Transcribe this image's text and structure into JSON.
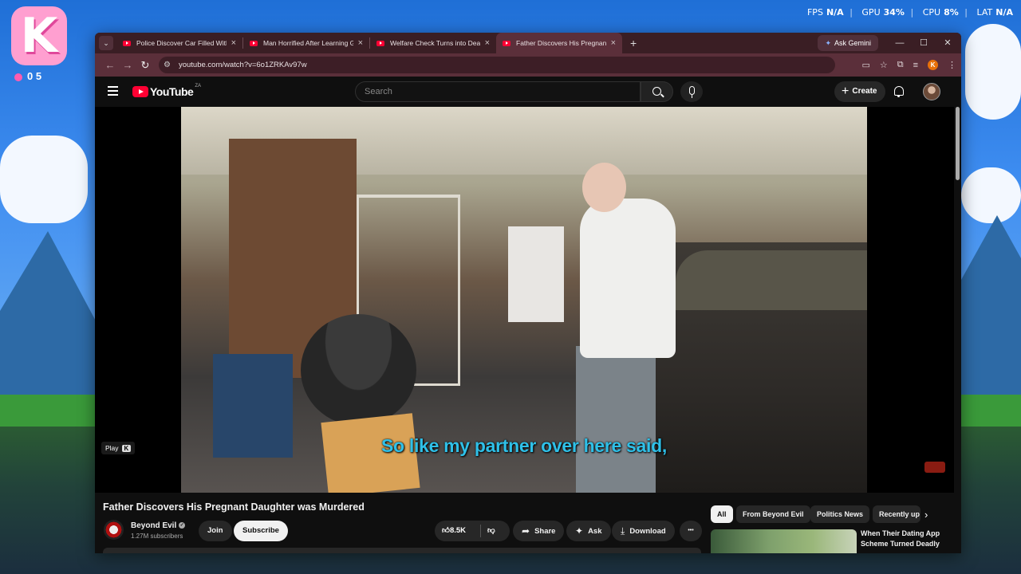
{
  "desktop": {
    "logo_letter": "K",
    "logo_counter": "0 5",
    "stats": {
      "fps_label": "FPS",
      "fps_value": "N/A",
      "gpu_label": "GPU",
      "gpu_value": "34%",
      "cpu_label": "CPU",
      "cpu_value": "8%",
      "lat_label": "LAT",
      "lat_value": "N/A"
    }
  },
  "browser": {
    "tabs": [
      {
        "title": "Police Discover Car Filled With",
        "close": "×"
      },
      {
        "title": "Man Horrified After Learning Gi",
        "close": "×"
      },
      {
        "title": "Welfare Check Turns into Dead",
        "close": "×"
      },
      {
        "title": "Father Discovers His Pregnant D",
        "close": "×",
        "active": true
      }
    ],
    "new_tab": "+",
    "ask_gemini": "Ask Gemini",
    "url": "youtube.com/watch?v=6o1ZRKAv97w",
    "profile_letter": "K"
  },
  "youtube": {
    "logo_word": "YouTube",
    "country_code": "ZA",
    "search_placeholder": "Search",
    "create_label": "Create",
    "player": {
      "subtitle": "So like my partner over here said,",
      "play_hint": "Play",
      "play_key": "K"
    },
    "video": {
      "title": "Father Discovers His Pregnant Daughter was Murdered",
      "channel": "Beyond Evil",
      "subscribers": "1.27M subscribers",
      "join_label": "Join",
      "subscribe_label": "Subscribe",
      "likes": "8.5K",
      "share_label": "Share",
      "ask_label": "Ask",
      "download_label": "Download",
      "more_label": "•••"
    },
    "chips": [
      "All",
      "From Beyond Evil",
      "Politics News",
      "Recently up"
    ],
    "recommendation": {
      "title": "When Their Dating App Scheme Turned Deadly"
    }
  }
}
